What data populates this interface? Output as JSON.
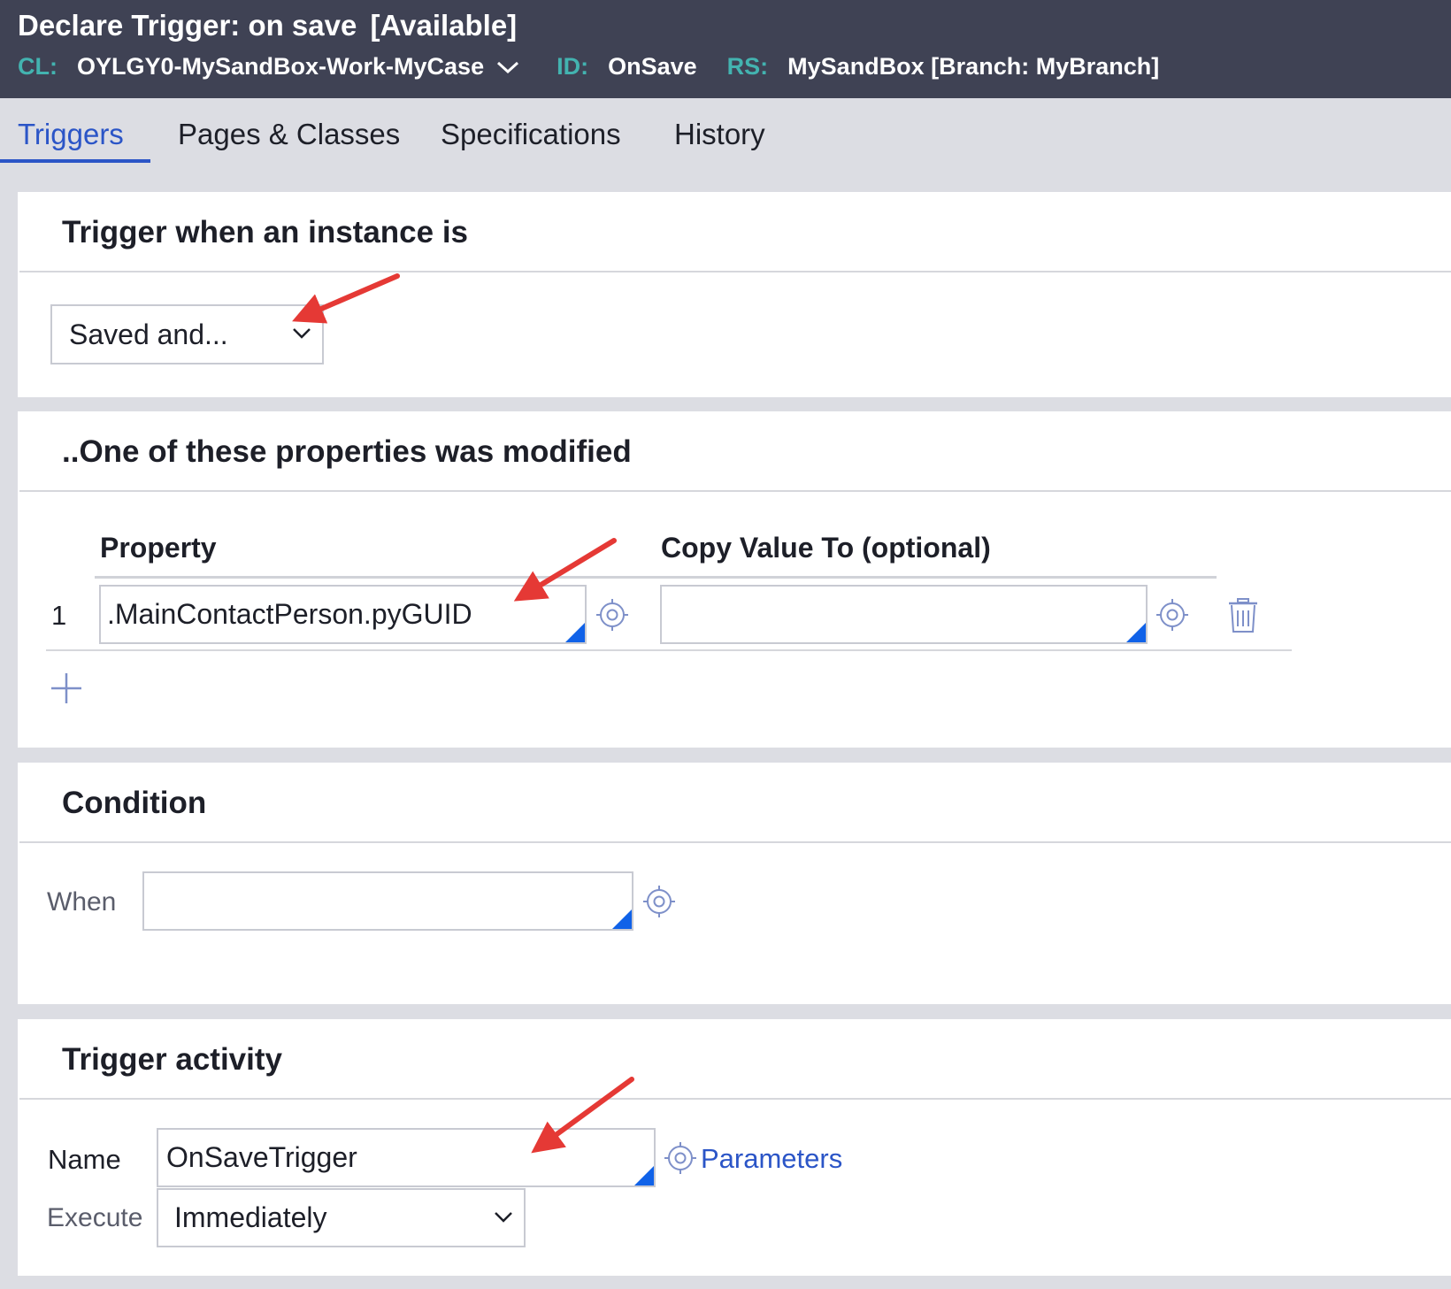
{
  "header": {
    "title": "Declare Trigger: on save",
    "status": "[Available]",
    "class_label": "CL:",
    "class_value": "OYLGY0-MySandBox-Work-MyCase",
    "id_label": "ID:",
    "id_value": "OnSave",
    "rs_label": "RS:",
    "rs_value": "MySandBox [Branch: MyBranch]"
  },
  "tabs": [
    {
      "label": "Triggers",
      "active": true
    },
    {
      "label": "Pages & Classes",
      "active": false
    },
    {
      "label": "Specifications",
      "active": false
    },
    {
      "label": "History",
      "active": false
    }
  ],
  "trigger_when": {
    "title": "Trigger when an instance is",
    "selected": "Saved and..."
  },
  "properties": {
    "title": "..One of these properties was modified",
    "col_property": "Property",
    "col_copy": "Copy Value To (optional)",
    "rows": [
      {
        "index": "1",
        "property": ".MainContactPerson.pyGUID",
        "copy_to": ""
      }
    ]
  },
  "condition": {
    "title": "Condition",
    "when_label": "When",
    "when_value": ""
  },
  "trigger_activity": {
    "title": "Trigger activity",
    "name_label": "Name",
    "name_value": "OnSaveTrigger",
    "parameters_link": "Parameters",
    "execute_label": "Execute",
    "execute_value": "Immediately"
  },
  "colors": {
    "header_bg": "#3f4254",
    "meta_key": "#43b3b0",
    "accent": "#2b55c7",
    "annotation_arrow": "#e53935"
  }
}
